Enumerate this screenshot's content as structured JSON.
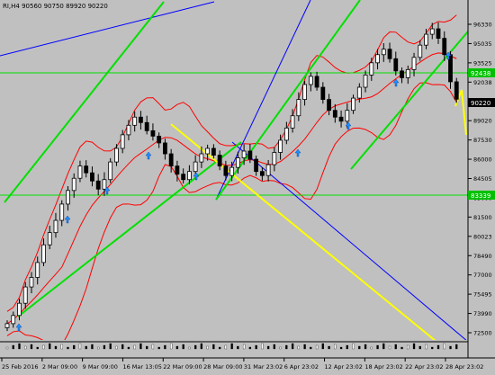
{
  "chart_data": {
    "type": "candlestick",
    "symbol": "RI,H4",
    "ohlc_header": "90560 90750 89920 90220",
    "y_ticks": [
      "96330",
      "95035",
      "93525",
      "92038",
      "90505",
      "89020",
      "87530",
      "86000",
      "84505",
      "83000",
      "81500",
      "80023",
      "78490",
      "77000",
      "75495",
      "73990",
      "72500"
    ],
    "x_ticks": [
      "25 Feb 2016",
      "2 Mar 09:00",
      "9 Mar 09:00",
      "16 Mar 13:05",
      "22 Mar 09:00",
      "28 Mar 09:00",
      "31 Mar 23:02",
      "6 Apr 23:02",
      "12 Apr 23:02",
      "18 Apr 23:02",
      "22 Apr 23:02",
      "28 Apr 23:02"
    ],
    "price_labels": [
      {
        "text": "92438",
        "bg": "#00c000"
      },
      {
        "text": "90220",
        "bg": "#000000"
      },
      {
        "text": "83339",
        "bg": "#00c000"
      }
    ],
    "ylim": [
      72500,
      96330
    ],
    "closes": [
      73700,
      74300,
      75200,
      76400,
      77100,
      78200,
      79500,
      80400,
      81300,
      82500,
      83500,
      84400,
      85300,
      84800,
      84200,
      83600,
      84300,
      85600,
      86600,
      87600,
      88300,
      88900,
      88500,
      87900,
      87500,
      87000,
      86200,
      85300,
      84700,
      84300,
      84900,
      85600,
      86200,
      86600,
      86100,
      85300,
      84600,
      85200,
      85900,
      86400,
      85800,
      84900,
      84600,
      85400,
      86300,
      87200,
      88100,
      89000,
      90200,
      91300,
      91900,
      91100,
      90200,
      89400,
      88900,
      88600,
      89400,
      90300,
      91100,
      92000,
      92900,
      93500,
      93900,
      93200,
      92300,
      91800,
      92400,
      93300,
      94200,
      95000,
      95400,
      94700,
      93500,
      91500,
      90220
    ],
    "green_color": "#00e000",
    "yellow_color": "#ffff00",
    "blue_color": "#0000ff",
    "band_color": "#ff0000",
    "arrow_color": "#1e90ff"
  }
}
